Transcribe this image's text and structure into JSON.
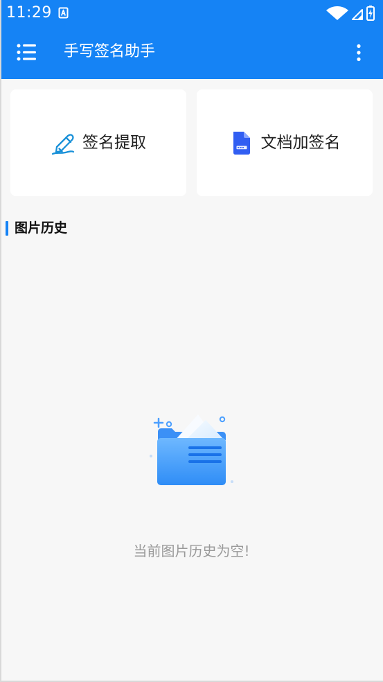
{
  "status_bar": {
    "time": "11:29",
    "notification_icon": "text-a-notification-icon",
    "wifi_icon": "wifi-icon",
    "signal_icon": "cell-signal-icon",
    "battery_icon": "battery-charging-icon"
  },
  "app_bar": {
    "title": "手写签名助手",
    "menu_icon": "list-menu-icon",
    "more_icon": "more-vertical-icon"
  },
  "actions": [
    {
      "label": "签名提取",
      "icon": "pen-signature-icon"
    },
    {
      "label": "文档加签名",
      "icon": "document-icon"
    }
  ],
  "history": {
    "title": "图片历史",
    "empty_message": "当前图片历史为空!"
  },
  "colors": {
    "primary": "#1583f5",
    "background": "#f7f7f7",
    "card": "#ffffff",
    "empty_text": "#9a9a9a",
    "document_icon": "#315ef2",
    "pen_icon": "#1890d8"
  }
}
